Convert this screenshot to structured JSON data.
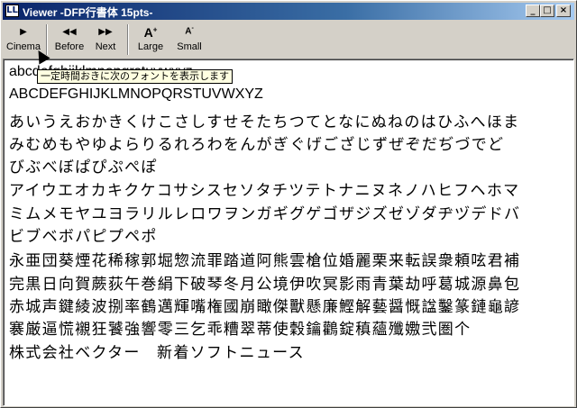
{
  "window": {
    "title": "Viewer -DFP行書体  15pts-",
    "icon_label": "LL"
  },
  "toolbar": {
    "cinema_label": "Cinema",
    "before_label": "Before",
    "next_label": "Next",
    "large_label": "Large",
    "small_label": "Small"
  },
  "tooltip": {
    "text": "一定時間おきに次のフォントを表示します"
  },
  "content": {
    "lines": [
      "abcdefghijklmnopqrstuvwxyz",
      "ABCDEFGHIJKLMNOPQRSTUVWXYZ",
      "あいうえおかきくけこさしすせそたちつてとなにぬねのはひふへほま",
      "みむめもやゆよらりるれろわをんがぎぐげござじずぜぞだぢづでど",
      "びぶべぼぱぴぷぺぽ",
      "アイウエオカキクケコサシスセソタチツテトナニヌネノハヒフヘホマ",
      "ミムメモヤユヨラリルレロワヲンガギグゲゴザジズゼゾダヂヅデドバ",
      "ビブベボパピプペポ",
      "永亜団葵煙花稀稼郭堀惣流罪踏道阿熊雲槍位婚麗栗来転誤衆頼呟君補",
      "完黒日向賀蕨荻午巻絹下破琴冬月公境伊吹冥影雨青葉劫呼葛城源鼻包",
      "赤城声鍵綾波捌率鶴邁輝嘴権國崩瞰傑獸懸廉鰹解藝醤慨諡鑿篆鏈龜諺",
      "褰厳逼慌襯狂饕強響零三乞乖糟翠蒂使穀鑰鸛錠稹蘊殲嫐弐圏个",
      "株式会社ベクター　新着ソフトニュース"
    ]
  },
  "colors": {
    "titlebar_start": "#0a246a",
    "titlebar_end": "#a6caf0",
    "chrome": "#d4d0c8",
    "tooltip_bg": "#ffffe1"
  }
}
